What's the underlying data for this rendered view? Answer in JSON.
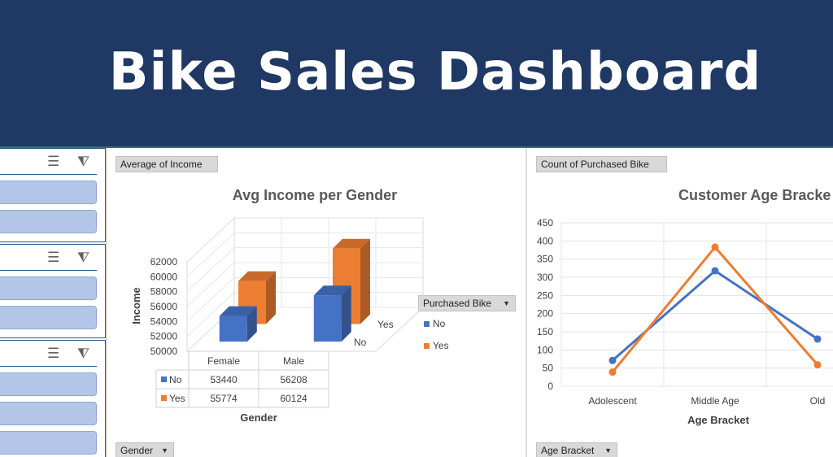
{
  "banner": {
    "title": "Bike Sales Dashboard"
  },
  "slicers": [
    {
      "icons": [
        "multi-select-icon",
        "clear-filter-icon"
      ],
      "item_count": 2
    },
    {
      "icons": [
        "multi-select-icon",
        "clear-filter-icon"
      ],
      "item_count": 2
    },
    {
      "icons": [
        "multi-select-icon",
        "clear-filter-icon"
      ],
      "item_count": 3
    }
  ],
  "left_panel": {
    "value_field": "Average of Income",
    "axis_field": "Gender",
    "legend_field": "Purchased Bike"
  },
  "right_panel": {
    "value_field": "Count of Purchased Bike",
    "axis_field": "Age Bracket"
  },
  "colors": {
    "no": "#4472c4",
    "yes": "#ed7d31",
    "banner": "#1f3864"
  },
  "chart_data": [
    {
      "type": "bar",
      "title": "Avg Income per Gender",
      "xlabel": "Gender",
      "ylabel": "Income",
      "categories": [
        "Female",
        "Male"
      ],
      "series": [
        {
          "name": "No",
          "values": [
            53440,
            56208
          ]
        },
        {
          "name": "Yes",
          "values": [
            55774,
            60124
          ]
        }
      ],
      "ylim": [
        50000,
        62000
      ],
      "yticks": [
        "50000",
        "52000",
        "54000",
        "56000",
        "58000",
        "60000",
        "62000"
      ],
      "depth_labels": [
        "Yes",
        "No"
      ],
      "legend": "right",
      "data_table": true,
      "grid": true
    },
    {
      "type": "line",
      "title": "Customer Age Bracke",
      "xlabel": "Age Bracket",
      "ylabel": "",
      "categories": [
        "Adolescent",
        "Middle Age",
        "Old"
      ],
      "series": [
        {
          "name": "No",
          "values": [
            71,
            318,
            130
          ]
        },
        {
          "name": "Yes",
          "values": [
            39,
            383,
            59
          ]
        }
      ],
      "ylim": [
        0,
        450
      ],
      "yticks": [
        "0",
        "50",
        "100",
        "150",
        "200",
        "250",
        "300",
        "350",
        "400",
        "450"
      ],
      "grid": true
    }
  ]
}
